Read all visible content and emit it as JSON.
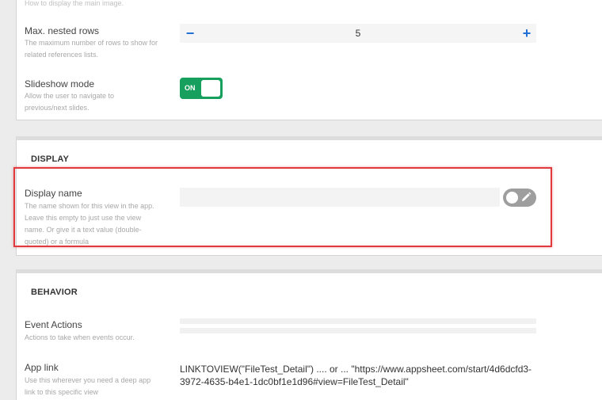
{
  "top_section": {
    "partial_description": "How to display the main image.",
    "max_nested_rows": {
      "label": "Max. nested rows",
      "description": "The maximum number of rows to show for related references lists.",
      "value": "5",
      "minus_symbol": "−",
      "plus_symbol": "+"
    },
    "slideshow_mode": {
      "label": "Slideshow mode",
      "description": "Allow the user to navigate to previous/next slides.",
      "toggle_text": "ON",
      "state": "on"
    }
  },
  "display_section": {
    "title": "DISPLAY",
    "display_name": {
      "label": "Display name",
      "description": "The name shown for this view in the app. Leave this empty to just use the view name. Or give it a text value (double-quoted) or a formula",
      "value": "",
      "formula_icon": "pencil-icon"
    }
  },
  "behavior_section": {
    "title": "BEHAVIOR",
    "event_actions": {
      "label": "Event Actions",
      "description": "Actions to take when events occur."
    },
    "app_link": {
      "label": "App link",
      "description": "Use this wherever you need a deep app link to this specific view",
      "value": "LINKTOVIEW(\"FileTest_Detail\") .... or ... \"https://www.appsheet.com/start/4d6dcfd3-3972-4635-b4e1-1dc0bf1e1d96#view=FileTest_Detail\""
    }
  },
  "colors": {
    "accent_blue": "#1f6fd6",
    "toggle_green": "#17a05d",
    "highlight_red": "#e0393e"
  }
}
